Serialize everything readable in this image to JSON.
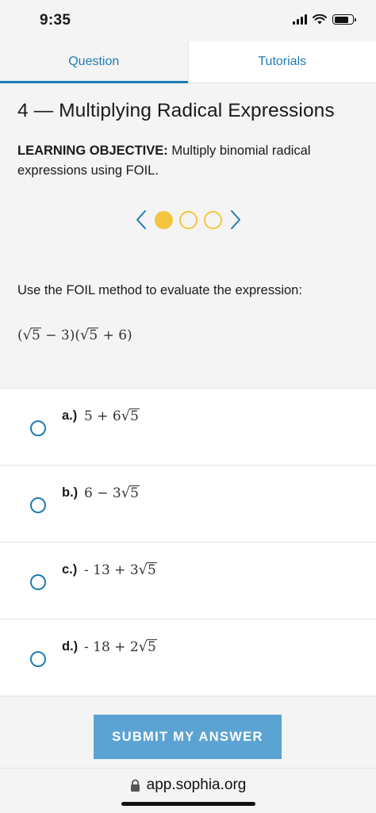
{
  "status_bar": {
    "time": "9:35"
  },
  "tabs": [
    {
      "label": "Question",
      "active": true
    },
    {
      "label": "Tutorials",
      "active": false
    }
  ],
  "lesson": {
    "title": "4 — Multiplying Radical Expressions",
    "objective_label": "LEARNING OBJECTIVE:",
    "objective_text": " Multiply binomial radical expressions using FOIL."
  },
  "pager": {
    "total": 3,
    "current": 1
  },
  "question": {
    "prompt": "Use the FOIL method to evaluate the expression:",
    "expression": {
      "open1": "(",
      "rad1": "5",
      "mid1": " − 3)(",
      "rad2": "5",
      "mid2": " + 6)"
    }
  },
  "options": [
    {
      "letter": "a.)",
      "prefix": "5 + 6",
      "radicand": "5"
    },
    {
      "letter": "b.)",
      "prefix": "6 − 3",
      "radicand": "5"
    },
    {
      "letter": "c.)",
      "prefix": " - 13 + 3",
      "radicand": "5"
    },
    {
      "letter": "d.)",
      "prefix": " - 18 + 2",
      "radicand": "5"
    }
  ],
  "submit_label": "SUBMIT MY ANSWER",
  "url": "app.sophia.org",
  "colors": {
    "accent_blue": "#1f7cb4",
    "submit_blue": "#5ba3d3",
    "pager_yellow": "#f2c53d"
  },
  "icons": {
    "status": [
      "signal-icon",
      "wifi-icon",
      "battery-icon"
    ],
    "pager": [
      "chevron-left-icon",
      "chevron-right-icon"
    ],
    "url": "lock-icon"
  }
}
